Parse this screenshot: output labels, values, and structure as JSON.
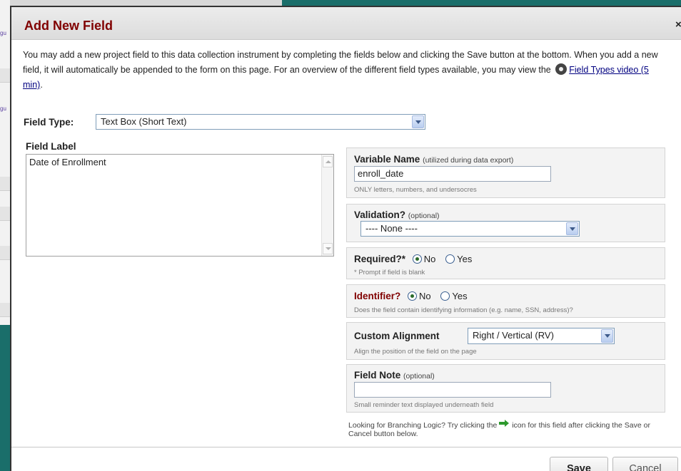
{
  "dialog": {
    "title": "Add New Field",
    "close_glyph": "×",
    "intro_text": "You may add a new project field to this data collection instrument by completing the fields below and clicking the Save button at the bottom. When you add a new field, it will automatically be appended to the form on this page. For an overview of the different field types available, you may view the",
    "video_link": "Field Types video (5 min)",
    "video_icon": "film-reel-icon"
  },
  "background": {
    "fragment": "gu"
  },
  "field_type": {
    "label": "Field Type:",
    "value": "Text Box (Short Text)"
  },
  "field_label": {
    "label": "Field Label",
    "value": "Date of Enrollment"
  },
  "variable_name": {
    "label": "Variable Name",
    "note": "(utilized during data export)",
    "value": "enroll_date",
    "hint": "ONLY letters, numbers, and undersocres"
  },
  "validation": {
    "label": "Validation?",
    "note": "(optional)",
    "value": "---- None ----"
  },
  "required": {
    "label": "Required?*",
    "no_label": "No",
    "yes_label": "Yes",
    "selected": "No",
    "hint": "* Prompt if field is blank"
  },
  "identifier": {
    "label": "Identifier?",
    "no_label": "No",
    "yes_label": "Yes",
    "selected": "No",
    "hint": "Does the field contain identifying information (e.g. name, SSN, address)?",
    "label_color": "#800000"
  },
  "custom_alignment": {
    "label": "Custom Alignment",
    "value": "Right / Vertical (RV)",
    "hint": "Align the position of the field on the page"
  },
  "field_note": {
    "label": "Field Note",
    "note": "(optional)",
    "value": "",
    "hint": "Small reminder text displayed underneath field"
  },
  "branching": {
    "text_before": "Looking for Branching Logic? Try clicking the",
    "text_after": "icon for this field after clicking the Save or Cancel button below.",
    "icon": "branching-arrow-icon"
  },
  "buttons": {
    "save": "Save",
    "cancel": "Cancel"
  },
  "colors": {
    "title": "#800000",
    "teal_background": "#1a6e6a",
    "link": "#000080"
  }
}
